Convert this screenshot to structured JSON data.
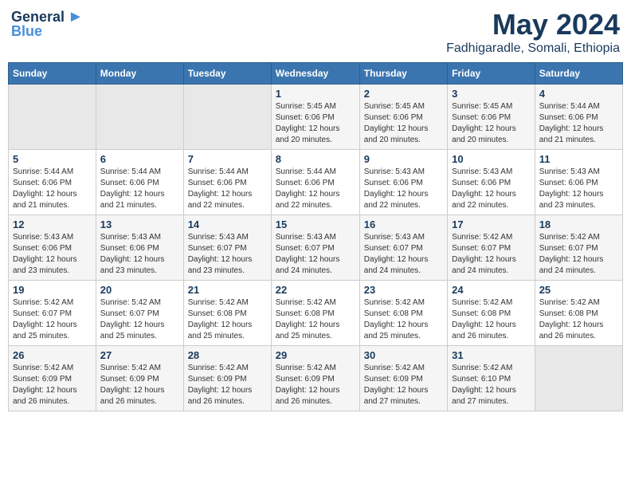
{
  "logo": {
    "line1": "General",
    "line2": "Blue"
  },
  "title": "May 2024",
  "location": "Fadhigaradle, Somali, Ethiopia",
  "days_of_week": [
    "Sunday",
    "Monday",
    "Tuesday",
    "Wednesday",
    "Thursday",
    "Friday",
    "Saturday"
  ],
  "weeks": [
    [
      {
        "day": "",
        "info": ""
      },
      {
        "day": "",
        "info": ""
      },
      {
        "day": "",
        "info": ""
      },
      {
        "day": "1",
        "info": "Sunrise: 5:45 AM\nSunset: 6:06 PM\nDaylight: 12 hours\nand 20 minutes."
      },
      {
        "day": "2",
        "info": "Sunrise: 5:45 AM\nSunset: 6:06 PM\nDaylight: 12 hours\nand 20 minutes."
      },
      {
        "day": "3",
        "info": "Sunrise: 5:45 AM\nSunset: 6:06 PM\nDaylight: 12 hours\nand 20 minutes."
      },
      {
        "day": "4",
        "info": "Sunrise: 5:44 AM\nSunset: 6:06 PM\nDaylight: 12 hours\nand 21 minutes."
      }
    ],
    [
      {
        "day": "5",
        "info": "Sunrise: 5:44 AM\nSunset: 6:06 PM\nDaylight: 12 hours\nand 21 minutes."
      },
      {
        "day": "6",
        "info": "Sunrise: 5:44 AM\nSunset: 6:06 PM\nDaylight: 12 hours\nand 21 minutes."
      },
      {
        "day": "7",
        "info": "Sunrise: 5:44 AM\nSunset: 6:06 PM\nDaylight: 12 hours\nand 22 minutes."
      },
      {
        "day": "8",
        "info": "Sunrise: 5:44 AM\nSunset: 6:06 PM\nDaylight: 12 hours\nand 22 minutes."
      },
      {
        "day": "9",
        "info": "Sunrise: 5:43 AM\nSunset: 6:06 PM\nDaylight: 12 hours\nand 22 minutes."
      },
      {
        "day": "10",
        "info": "Sunrise: 5:43 AM\nSunset: 6:06 PM\nDaylight: 12 hours\nand 22 minutes."
      },
      {
        "day": "11",
        "info": "Sunrise: 5:43 AM\nSunset: 6:06 PM\nDaylight: 12 hours\nand 23 minutes."
      }
    ],
    [
      {
        "day": "12",
        "info": "Sunrise: 5:43 AM\nSunset: 6:06 PM\nDaylight: 12 hours\nand 23 minutes."
      },
      {
        "day": "13",
        "info": "Sunrise: 5:43 AM\nSunset: 6:06 PM\nDaylight: 12 hours\nand 23 minutes."
      },
      {
        "day": "14",
        "info": "Sunrise: 5:43 AM\nSunset: 6:07 PM\nDaylight: 12 hours\nand 23 minutes."
      },
      {
        "day": "15",
        "info": "Sunrise: 5:43 AM\nSunset: 6:07 PM\nDaylight: 12 hours\nand 24 minutes."
      },
      {
        "day": "16",
        "info": "Sunrise: 5:43 AM\nSunset: 6:07 PM\nDaylight: 12 hours\nand 24 minutes."
      },
      {
        "day": "17",
        "info": "Sunrise: 5:42 AM\nSunset: 6:07 PM\nDaylight: 12 hours\nand 24 minutes."
      },
      {
        "day": "18",
        "info": "Sunrise: 5:42 AM\nSunset: 6:07 PM\nDaylight: 12 hours\nand 24 minutes."
      }
    ],
    [
      {
        "day": "19",
        "info": "Sunrise: 5:42 AM\nSunset: 6:07 PM\nDaylight: 12 hours\nand 25 minutes."
      },
      {
        "day": "20",
        "info": "Sunrise: 5:42 AM\nSunset: 6:07 PM\nDaylight: 12 hours\nand 25 minutes."
      },
      {
        "day": "21",
        "info": "Sunrise: 5:42 AM\nSunset: 6:08 PM\nDaylight: 12 hours\nand 25 minutes."
      },
      {
        "day": "22",
        "info": "Sunrise: 5:42 AM\nSunset: 6:08 PM\nDaylight: 12 hours\nand 25 minutes."
      },
      {
        "day": "23",
        "info": "Sunrise: 5:42 AM\nSunset: 6:08 PM\nDaylight: 12 hours\nand 25 minutes."
      },
      {
        "day": "24",
        "info": "Sunrise: 5:42 AM\nSunset: 6:08 PM\nDaylight: 12 hours\nand 26 minutes."
      },
      {
        "day": "25",
        "info": "Sunrise: 5:42 AM\nSunset: 6:08 PM\nDaylight: 12 hours\nand 26 minutes."
      }
    ],
    [
      {
        "day": "26",
        "info": "Sunrise: 5:42 AM\nSunset: 6:09 PM\nDaylight: 12 hours\nand 26 minutes."
      },
      {
        "day": "27",
        "info": "Sunrise: 5:42 AM\nSunset: 6:09 PM\nDaylight: 12 hours\nand 26 minutes."
      },
      {
        "day": "28",
        "info": "Sunrise: 5:42 AM\nSunset: 6:09 PM\nDaylight: 12 hours\nand 26 minutes."
      },
      {
        "day": "29",
        "info": "Sunrise: 5:42 AM\nSunset: 6:09 PM\nDaylight: 12 hours\nand 26 minutes."
      },
      {
        "day": "30",
        "info": "Sunrise: 5:42 AM\nSunset: 6:09 PM\nDaylight: 12 hours\nand 27 minutes."
      },
      {
        "day": "31",
        "info": "Sunrise: 5:42 AM\nSunset: 6:10 PM\nDaylight: 12 hours\nand 27 minutes."
      },
      {
        "day": "",
        "info": ""
      }
    ]
  ]
}
